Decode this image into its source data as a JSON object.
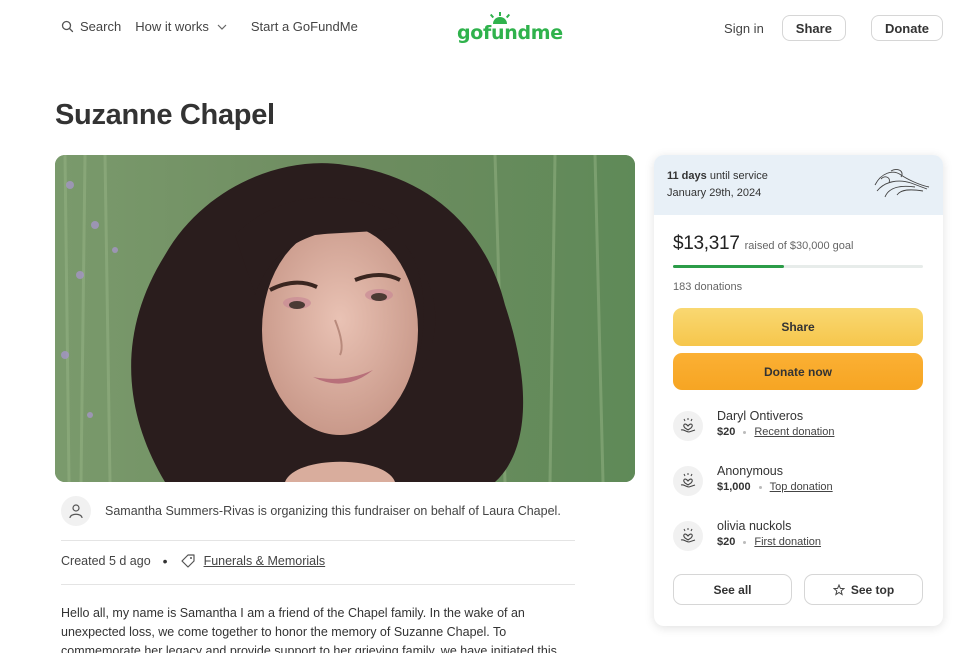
{
  "header": {
    "search_label": "Search",
    "how_it_works_label": "How it works",
    "start_label": "Start a GoFundMe",
    "logo_text": "gofundme",
    "sign_in_label": "Sign in",
    "share_label": "Share",
    "donate_label": "Donate",
    "brand_color": "#2fb24c"
  },
  "campaign": {
    "title": "Suzanne Chapel",
    "hero_alt": "Photo of Suzanne Chapel",
    "organizer_text": "Samantha Summers-Rivas is organizing this fundraiser on behalf of Laura Chapel.",
    "created": "Created 5 d ago",
    "category": "Funerals & Memorials",
    "story": "Hello all, my name is Samantha I am a friend of the Chapel family. In the wake of an unexpected loss, we come together to honor the memory of Suzanne Chapel. To commemorate her legacy and provide support to her grieving family, we have initiated this"
  },
  "card": {
    "days_bold": "11 days",
    "days_rest": " until service",
    "service_date": "January 29th, 2024",
    "raised": "$13,317",
    "goal_text": "raised of $30,000 goal",
    "progress_percent": 44.4,
    "donations_count": "183 donations",
    "share_label": "Share",
    "donate_now_label": "Donate now",
    "donors": [
      {
        "name": "Daryl Ontiveros",
        "amount": "$20",
        "type": "Recent donation"
      },
      {
        "name": "Anonymous",
        "amount": "$1,000",
        "type": "Top donation"
      },
      {
        "name": "olivia nuckols",
        "amount": "$20",
        "type": "First donation"
      }
    ],
    "see_all_label": "See all",
    "see_top_label": "See top",
    "share_color": "#f8cf5f",
    "donate_color": "#f8aa2a",
    "progress_color": "#2b9c48"
  }
}
